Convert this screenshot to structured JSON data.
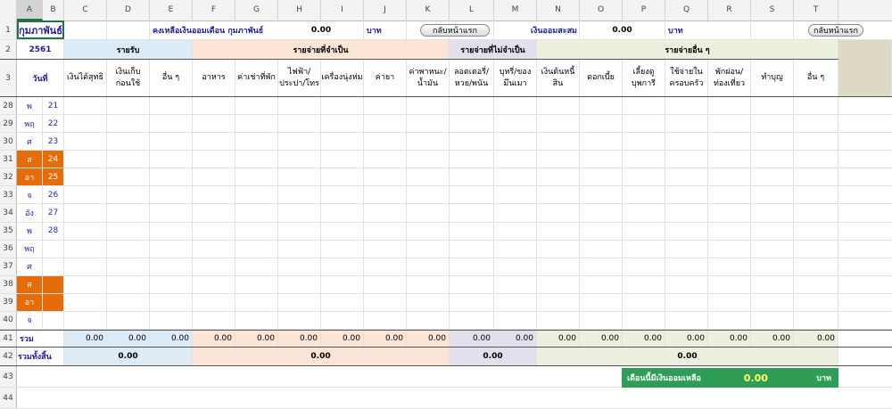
{
  "column_headers": [
    "A",
    "B",
    "C",
    "D",
    "E",
    "F",
    "G",
    "H",
    "I",
    "J",
    "K",
    "L",
    "M",
    "N",
    "O",
    "P",
    "Q",
    "R",
    "S",
    "T"
  ],
  "row1": {
    "month_cell": "กุมภาพันธ์",
    "balance_label": "คงเหลือเงินออมเดือน กุมภาพันธ์",
    "balance_value": "0.00",
    "unit1": "บาท",
    "back_button1": "กลับหน้าแรก",
    "savings_label": "เงินออมสะสม",
    "savings_value": "0.00",
    "unit2": "บาท",
    "back_button2": "กลับหน้าแรก"
  },
  "row2": {
    "year": "2561",
    "income_group": "รายรับ",
    "essential_group": "รายจ่ายที่จำเป็น",
    "nonessential_group": "รายจ่ายที่ไม่จำเป็น",
    "other_group": "รายจ่ายอื่น ๆ"
  },
  "row3": {
    "date_label": "วันที่",
    "c": "เงินได้สุทธิ",
    "d": "เงินเก็บ|ก่อนใช้",
    "e": "อื่น ๆ",
    "f": "อาหาร",
    "g": "ค่าเช่าที่พัก",
    "h": "ไฟฟ้า/|ประปา/โทร",
    "i": "เครื่องนุ่งห่ม",
    "j": "ค่ายา",
    "k": "ค่าพาหนะ/|น้ำมัน",
    "l": "ลอตเตอรี่/|หวย/พนัน",
    "m": "บุหรี่/ของ|มึนเมา",
    "n": "เงินต้นหนี้สิน",
    "o": "ดอกเบี้ย",
    "p": "เลี้ยงดู|บุพการี",
    "q": "ใช้จ่ายใน|ครอบครัว",
    "r": "พักผ่อน/|ท่องเที่ยว",
    "s": "ทำบุญ",
    "t": "อื่น ๆ"
  },
  "day_rows": [
    {
      "row": "28",
      "day": "พ",
      "date": "21",
      "weekend": false
    },
    {
      "row": "29",
      "day": "พฤ",
      "date": "22",
      "weekend": false
    },
    {
      "row": "30",
      "day": "ศ",
      "date": "23",
      "weekend": false
    },
    {
      "row": "31",
      "day": "ส",
      "date": "24",
      "weekend": true
    },
    {
      "row": "32",
      "day": "อา",
      "date": "25",
      "weekend": true
    },
    {
      "row": "33",
      "day": "จ",
      "date": "26",
      "weekend": false
    },
    {
      "row": "34",
      "day": "อัง",
      "date": "27",
      "weekend": false
    },
    {
      "row": "35",
      "day": "พ",
      "date": "28",
      "weekend": false
    },
    {
      "row": "36",
      "day": "พฤ",
      "date": "",
      "weekend": false
    },
    {
      "row": "37",
      "day": "ศ",
      "date": "",
      "weekend": false
    },
    {
      "row": "38",
      "day": "ส",
      "date": "",
      "weekend": true
    },
    {
      "row": "39",
      "day": "อา",
      "date": "",
      "weekend": true
    },
    {
      "row": "40",
      "day": "จ",
      "date": "",
      "weekend": false
    }
  ],
  "row41": {
    "label": "รวม",
    "values": [
      "0.00",
      "0.00",
      "0.00",
      "0.00",
      "0.00",
      "0.00",
      "0.00",
      "0.00",
      "0.00",
      "0.00",
      "0.00",
      "0.00",
      "0.00",
      "0.00",
      "0.00",
      "0.00",
      "0.00",
      "0.00"
    ]
  },
  "row42": {
    "label": "รวมทั้งสิ้น",
    "income_total": "0.00",
    "essential_total": "0.00",
    "nonessential_total": "0.00",
    "other_total": "0.00"
  },
  "row43": {
    "summary_label": "เดือนนี้มีเงินออมเหลือ",
    "summary_value": "0.00",
    "summary_unit": "บาท"
  },
  "extra_rows": [
    "43",
    "44"
  ],
  "colors": {
    "weekend": "#e46c0a",
    "income_bg": "#ddebf7",
    "essential_bg": "#fce4d6",
    "nonessential_bg": "#e4dfec",
    "other_bg": "#ebf1de",
    "summary_bg": "#2e9e57"
  }
}
